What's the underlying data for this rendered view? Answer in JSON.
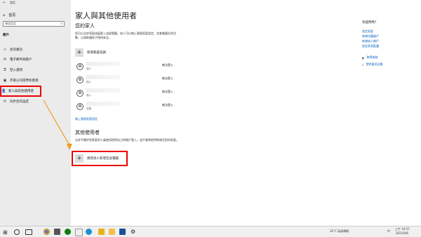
{
  "window": {
    "title": "設定",
    "back": "←"
  },
  "sidebar": {
    "home": "首頁",
    "search_placeholder": "尋找設定",
    "section": "帳戶",
    "items": [
      {
        "label": "您的資訊",
        "icon": "person-card-icon"
      },
      {
        "label": "電子郵件與帳戶",
        "icon": "mail-icon"
      },
      {
        "label": "登入選項",
        "icon": "key-icon"
      },
      {
        "label": "存取公司或學校資源",
        "icon": "briefcase-icon"
      },
      {
        "label": "家人與其他使用者",
        "icon": "people-icon"
      },
      {
        "label": "同步您的設定",
        "icon": "sync-icon"
      }
    ]
  },
  "main": {
    "title": "家人與其他使用者",
    "family": {
      "heading": "您的家人",
      "description": "您可以允許家庭成員登入這部電腦。成人可以線上管理家庭設定，並查看最近的活動，以協助讓孩子保持安全。",
      "add_label": "新增家庭成員",
      "members": [
        {
          "role": "成人",
          "status": "無法登入"
        },
        {
          "role": "成人",
          "status": "無法登入"
        },
        {
          "role": "成人",
          "status": "無法登入"
        },
        {
          "role": "兒童",
          "status": "無法登入"
        }
      ],
      "manage_link": "線上管理家庭設定"
    },
    "other": {
      "heading": "其他使用者",
      "description": "允許不屬於您家庭的人員使用他們自己的帳戶登入。這不會將他們新增至您的家庭。",
      "add_label": "將其他人新增至此電腦"
    }
  },
  "right": {
    "title": "有疑問嗎?",
    "links": [
      "設定家庭",
      "新增兒童帳戶",
      "新增成人帳戶",
      "設定家長監護"
    ],
    "help": [
      {
        "label": "取得協助",
        "icon": "help-icon"
      },
      {
        "label": "提供意見反應",
        "icon": "feedback-icon"
      }
    ]
  },
  "taskbar": {
    "temperature": "32°C 局部晴朗",
    "ime": "中",
    "time": "上午 10:57",
    "date": "2021/6/6"
  }
}
